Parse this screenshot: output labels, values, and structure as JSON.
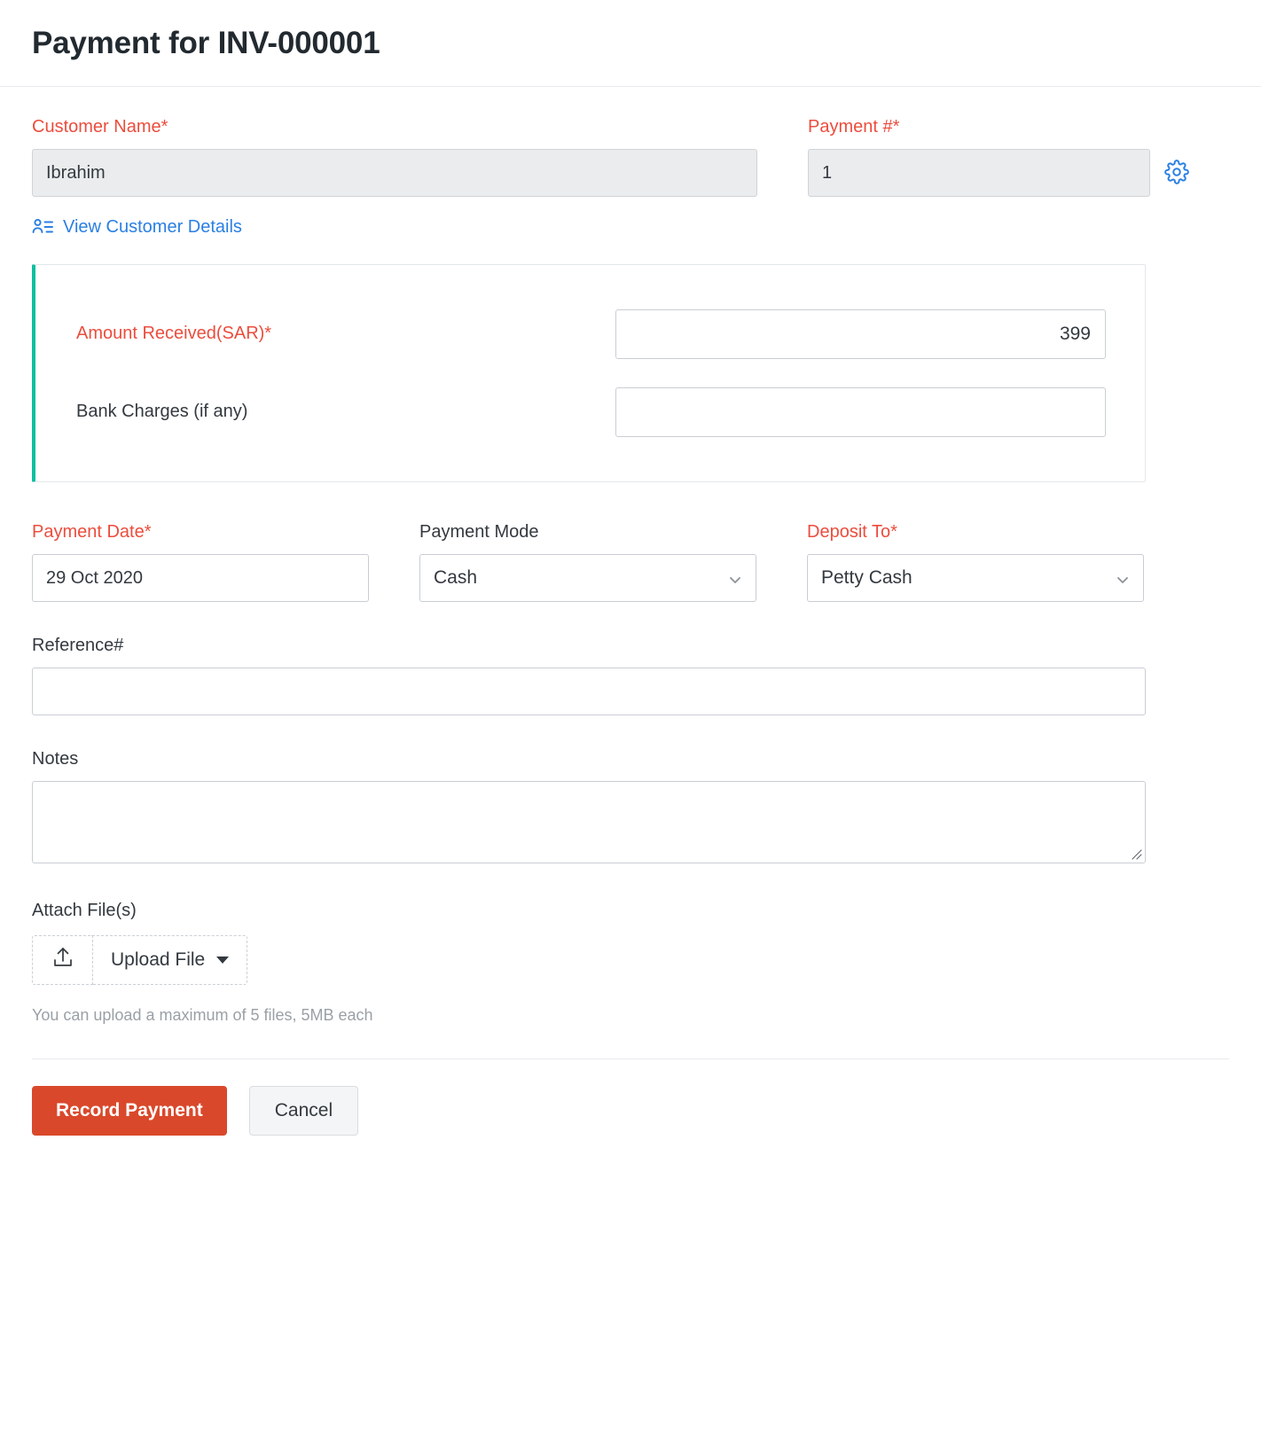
{
  "header": {
    "title": "Payment for INV-000001"
  },
  "customer": {
    "label": "Customer Name*",
    "value": "Ibrahim",
    "view_details_label": "View Customer Details"
  },
  "payment_number": {
    "label": "Payment #*",
    "value": "1",
    "settings_icon": "gear-icon"
  },
  "amount_card": {
    "accent_color": "#0cbfa0",
    "amount_received": {
      "label": "Amount Received(SAR)*",
      "value": "399"
    },
    "bank_charges": {
      "label": "Bank Charges (if any)",
      "value": ""
    }
  },
  "payment_date": {
    "label": "Payment Date*",
    "value": "29 Oct 2020"
  },
  "payment_mode": {
    "label": "Payment Mode",
    "value": "Cash"
  },
  "deposit_to": {
    "label": "Deposit To*",
    "value": "Petty Cash"
  },
  "reference": {
    "label": "Reference#",
    "value": ""
  },
  "notes": {
    "label": "Notes",
    "value": ""
  },
  "attachments": {
    "label": "Attach File(s)",
    "upload_button_label": "Upload File",
    "upload_icon": "upload-icon",
    "hint": "You can upload a maximum of 5 files, 5MB each"
  },
  "footer": {
    "submit_label": "Record Payment",
    "cancel_label": "Cancel",
    "primary_color": "#d9482b"
  }
}
